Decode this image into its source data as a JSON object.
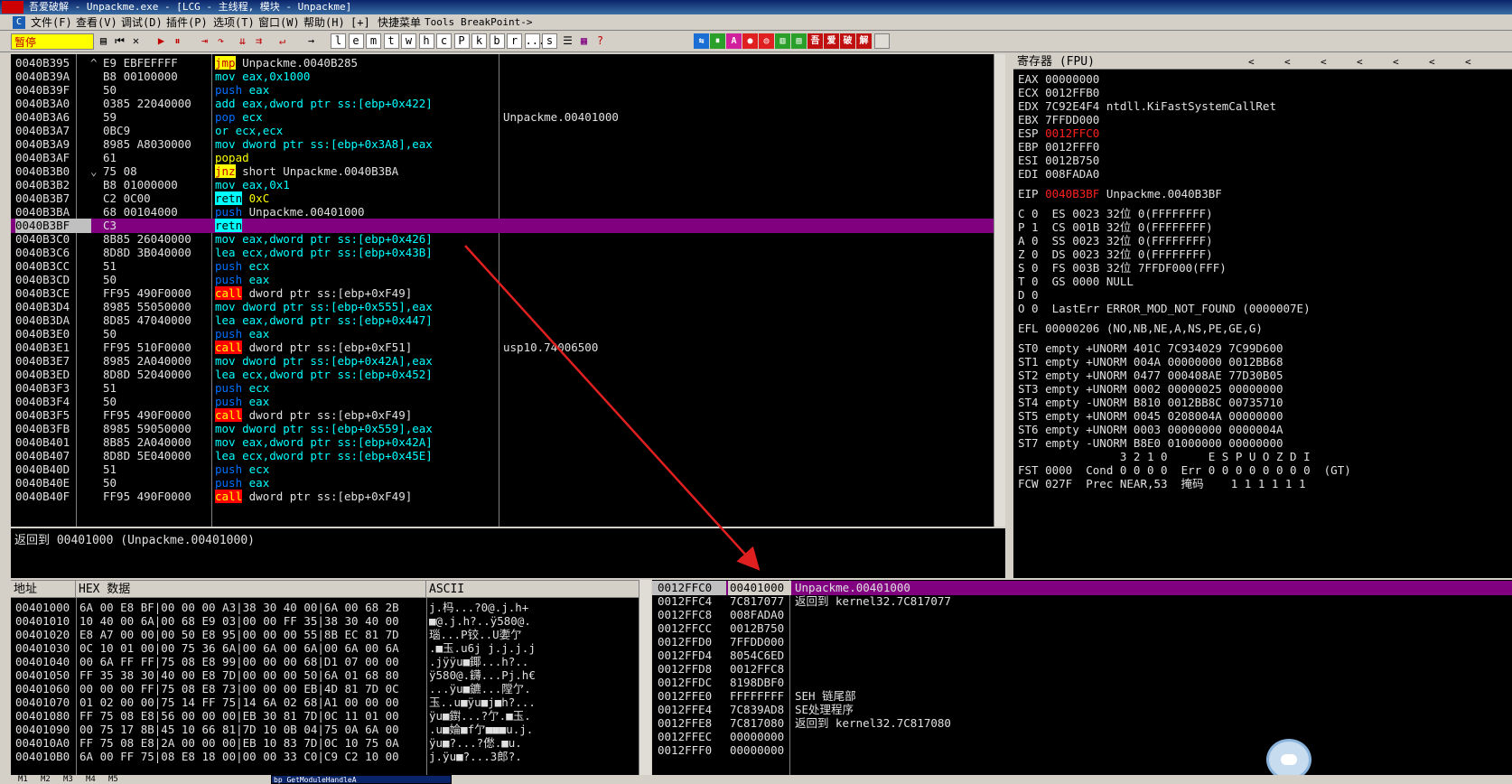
{
  "window": {
    "title": "吾爱破解 - Unpackme.exe - [LCG - 主线程, 模块 - Unpackme]",
    "logo_text": "吾爱破解"
  },
  "menu": [
    {
      "label": "文件(F)"
    },
    {
      "label": "查看(V)"
    },
    {
      "label": "调试(D)"
    },
    {
      "label": "插件(P)"
    },
    {
      "label": "选项(T)"
    },
    {
      "label": "窗口(W)"
    },
    {
      "label": "帮助(H)"
    },
    {
      "label": "[+]"
    },
    {
      "label": "快捷菜单"
    },
    {
      "label": "Tools"
    },
    {
      "label": "BreakPoint->"
    }
  ],
  "toolbar": {
    "status": "暂停",
    "letter_buttons": [
      "l",
      "e",
      "m",
      "t",
      "w",
      "h",
      "c",
      "P",
      "k",
      "b",
      "r",
      "...",
      "s"
    ],
    "colors": {
      "accent_yellow": "#ffff00",
      "selection_purple": "#800080"
    }
  },
  "cpu": {
    "rows": [
      {
        "addr": "0040B395",
        "mark": "^",
        "hex": "E9 EBFEFFFF",
        "mn": "jmp",
        "ops": "Unpackme.0040B285",
        "comment": ""
      },
      {
        "addr": "0040B39A",
        "mark": "",
        "hex": "B8 00100000",
        "mn": "mov",
        "ops": "eax,0x1000",
        "comment": ""
      },
      {
        "addr": "0040B39F",
        "mark": "",
        "hex": "50",
        "mn": "push",
        "ops": "eax",
        "comment": ""
      },
      {
        "addr": "0040B3A0",
        "mark": "",
        "hex": "0385 22040000",
        "mn": "add",
        "ops": "eax,dword ptr ss:[ebp+0x422]",
        "comment": ""
      },
      {
        "addr": "0040B3A6",
        "mark": "",
        "hex": "59",
        "mn": "pop",
        "ops": "ecx",
        "comment": "Unpackme.00401000"
      },
      {
        "addr": "0040B3A7",
        "mark": "",
        "hex": "0BC9",
        "mn": "or",
        "ops": "ecx,ecx",
        "comment": ""
      },
      {
        "addr": "0040B3A9",
        "mark": "",
        "hex": "8985 A8030000",
        "mn": "mov",
        "ops": "dword ptr ss:[ebp+0x3A8],eax",
        "comment": ""
      },
      {
        "addr": "0040B3AF",
        "mark": "",
        "hex": "61",
        "mn": "popad",
        "ops": "",
        "comment": ""
      },
      {
        "addr": "0040B3B0",
        "mark": "⌄",
        "hex": "75 08",
        "mn": "jnz",
        "ops": "short Unpackme.0040B3BA",
        "comment": ""
      },
      {
        "addr": "0040B3B2",
        "mark": "",
        "hex": "B8 01000000",
        "mn": "mov",
        "ops": "eax,0x1",
        "comment": ""
      },
      {
        "addr": "0040B3B7",
        "mark": "",
        "hex": "C2 0C00",
        "mn": "retn",
        "ops": "0xC",
        "comment": ""
      },
      {
        "addr": "0040B3BA",
        "mark": "",
        "hex": "68 00104000",
        "mn": "push",
        "ops": "Unpackme.00401000",
        "comment": ""
      },
      {
        "addr": "0040B3BF",
        "mark": "",
        "hex": "C3",
        "mn": "retn",
        "ops": "",
        "comment": "",
        "selected": true
      },
      {
        "addr": "0040B3C0",
        "mark": "",
        "hex": "8B85 26040000",
        "mn": "mov",
        "ops": "eax,dword ptr ss:[ebp+0x426]",
        "comment": ""
      },
      {
        "addr": "0040B3C6",
        "mark": "",
        "hex": "8D8D 3B040000",
        "mn": "lea",
        "ops": "ecx,dword ptr ss:[ebp+0x43B]",
        "comment": ""
      },
      {
        "addr": "0040B3CC",
        "mark": "",
        "hex": "51",
        "mn": "push",
        "ops": "ecx",
        "comment": ""
      },
      {
        "addr": "0040B3CD",
        "mark": "",
        "hex": "50",
        "mn": "push",
        "ops": "eax",
        "comment": ""
      },
      {
        "addr": "0040B3CE",
        "mark": "",
        "hex": "FF95 490F0000",
        "mn": "call",
        "ops": "dword ptr ss:[ebp+0xF49]",
        "comment": ""
      },
      {
        "addr": "0040B3D4",
        "mark": "",
        "hex": "8985 55050000",
        "mn": "mov",
        "ops": "dword ptr ss:[ebp+0x555],eax",
        "comment": ""
      },
      {
        "addr": "0040B3DA",
        "mark": "",
        "hex": "8D85 47040000",
        "mn": "lea",
        "ops": "eax,dword ptr ss:[ebp+0x447]",
        "comment": ""
      },
      {
        "addr": "0040B3E0",
        "mark": "",
        "hex": "50",
        "mn": "push",
        "ops": "eax",
        "comment": ""
      },
      {
        "addr": "0040B3E1",
        "mark": "",
        "hex": "FF95 510F0000",
        "mn": "call",
        "ops": "dword ptr ss:[ebp+0xF51]",
        "comment": "usp10.74006500"
      },
      {
        "addr": "0040B3E7",
        "mark": "",
        "hex": "8985 2A040000",
        "mn": "mov",
        "ops": "dword ptr ss:[ebp+0x42A],eax",
        "comment": ""
      },
      {
        "addr": "0040B3ED",
        "mark": "",
        "hex": "8D8D 52040000",
        "mn": "lea",
        "ops": "ecx,dword ptr ss:[ebp+0x452]",
        "comment": ""
      },
      {
        "addr": "0040B3F3",
        "mark": "",
        "hex": "51",
        "mn": "push",
        "ops": "ecx",
        "comment": ""
      },
      {
        "addr": "0040B3F4",
        "mark": "",
        "hex": "50",
        "mn": "push",
        "ops": "eax",
        "comment": ""
      },
      {
        "addr": "0040B3F5",
        "mark": "",
        "hex": "FF95 490F0000",
        "mn": "call",
        "ops": "dword ptr ss:[ebp+0xF49]",
        "comment": ""
      },
      {
        "addr": "0040B3FB",
        "mark": "",
        "hex": "8985 59050000",
        "mn": "mov",
        "ops": "dword ptr ss:[ebp+0x559],eax",
        "comment": ""
      },
      {
        "addr": "0040B401",
        "mark": "",
        "hex": "8B85 2A040000",
        "mn": "mov",
        "ops": "eax,dword ptr ss:[ebp+0x42A]",
        "comment": ""
      },
      {
        "addr": "0040B407",
        "mark": "",
        "hex": "8D8D 5E040000",
        "mn": "lea",
        "ops": "ecx,dword ptr ss:[ebp+0x45E]",
        "comment": ""
      },
      {
        "addr": "0040B40D",
        "mark": "",
        "hex": "51",
        "mn": "push",
        "ops": "ecx",
        "comment": ""
      },
      {
        "addr": "0040B40E",
        "mark": "",
        "hex": "50",
        "mn": "push",
        "ops": "eax",
        "comment": ""
      },
      {
        "addr": "0040B40F",
        "mark": "",
        "hex": "FF95 490F0000",
        "mn": "call",
        "ops": "dword ptr ss:[ebp+0xF49]",
        "comment": ""
      }
    ],
    "info": "返回到 00401000 (Unpackme.00401000)"
  },
  "registers": {
    "header": "寄存器 (FPU)",
    "lines": [
      {
        "t": "EAX 00000000"
      },
      {
        "t": "ECX 0012FFB0"
      },
      {
        "t": "EDX 7C92E4F4 ntdll.KiFastSystemCallRet"
      },
      {
        "t": "EBX 7FFDD000"
      },
      {
        "pre": "ESP ",
        "red": "0012FFC0",
        "post": ""
      },
      {
        "t": "EBP 0012FFF0"
      },
      {
        "t": "ESI 0012B750"
      },
      {
        "t": "EDI 008FADA0"
      },
      {
        "gap": true
      },
      {
        "pre": "EIP ",
        "red": "0040B3BF",
        "post": " Unpackme.0040B3BF"
      },
      {
        "gap": true
      },
      {
        "t": "C 0  ES 0023 32位 0(FFFFFFFF)"
      },
      {
        "t": "P 1  CS 001B 32位 0(FFFFFFFF)"
      },
      {
        "t": "A 0  SS 0023 32位 0(FFFFFFFF)"
      },
      {
        "t": "Z 0  DS 0023 32位 0(FFFFFFFF)"
      },
      {
        "t": "S 0  FS 003B 32位 7FFDF000(FFF)"
      },
      {
        "t": "T 0  GS 0000 NULL"
      },
      {
        "t": "D 0"
      },
      {
        "t": "O 0  LastErr ERROR_MOD_NOT_FOUND (0000007E)"
      },
      {
        "gap": true
      },
      {
        "t": "EFL 00000206 (NO,NB,NE,A,NS,PE,GE,G)"
      },
      {
        "gap": true
      },
      {
        "t": "ST0 empty +UNORM 401C 7C934029 7C99D600"
      },
      {
        "t": "ST1 empty +UNORM 004A 00000000 0012BB68"
      },
      {
        "t": "ST2 empty +UNORM 0477 000408AE 77D30B05"
      },
      {
        "t": "ST3 empty +UNORM 0002 00000025 00000000"
      },
      {
        "t": "ST4 empty -UNORM B810 0012BB8C 00735710"
      },
      {
        "t": "ST5 empty +UNORM 0045 0208004A 00000000"
      },
      {
        "t": "ST6 empty +UNORM 0003 00000000 0000004A"
      },
      {
        "t": "ST7 empty -UNORM B8E0 01000000 00000000"
      },
      {
        "t": "               3 2 1 0      E S P U O Z D I"
      },
      {
        "t": "FST 0000  Cond 0 0 0 0  Err 0 0 0 0 0 0 0 0  (GT)"
      },
      {
        "t": "FCW 027F  Prec NEAR,53  掩码    1 1 1 1 1 1"
      }
    ]
  },
  "dump": {
    "headers": {
      "addr": "地址",
      "hex": "HEX 数据",
      "ascii": "ASCII"
    },
    "rows": [
      {
        "a": "00401000",
        "h": "6A 00 E8 BF|00 00 00 A3|38 30 40 00|6A 00 68 2B",
        "s": "j.杩...?0@.j.h+"
      },
      {
        "a": "00401010",
        "h": "10 40 00 6A|00 68 E9 03|00 00 FF 35|38 30 40 00",
        "s": "■@.j.h?..ÿ580@."
      },
      {
        "a": "00401020",
        "h": "E8 A7 00 00|00 50 E8 95|00 00 00 55|8B EC 81 7D",
        "s": "瑙...P铰..U嬱亇"
      },
      {
        "a": "00401030",
        "h": "0C 10 01 00|00 75 36 6A|00 6A 00 6A|00 6A 00 6A",
        "s": ".■玉.u6j j.j.j.j"
      },
      {
        "a": "00401040",
        "h": "00 6A FF FF|75 08 E8 99|00 00 00 68|D1 07 00 00",
        "s": ".jÿÿu■鎁...h?.."
      },
      {
        "a": "00401050",
        "h": "FF 35 38 30|40 00 E8 7D|00 00 00 50|6A 01 68 80",
        "s": "ÿ580@.鑮...Pj.h€"
      },
      {
        "a": "00401060",
        "h": "00 00 00 FF|75 08 E8 73|00 00 00 EB|4D 81 7D 0C",
        "s": "...ÿu■鑣...隚亇."
      },
      {
        "a": "00401070",
        "h": "01 02 00 00|75 14 FF 75|14 6A 02 68|A1 00 00 00",
        "s": "玉..u■ÿu■j■h?..."
      },
      {
        "a": "00401080",
        "h": "FF 75 08 E8|56 00 00 00|EB 30 81 7D|0C 11 01 00",
        "s": "ÿu■鑆...?亇.■玉."
      },
      {
        "a": "00401090",
        "h": "00 75 17 8B|45 10 66 81|7D 10 0B 04|75 0A 6A 00",
        "s": ".u■婨■f亇■■■u.j."
      },
      {
        "a": "004010A0",
        "h": "FF 75 08 E8|2A 00 00 00|EB 10 83 7D|0C 10 75 0A",
        "s": "ÿu■?...?僽.■u."
      },
      {
        "a": "004010B0",
        "h": "6A 00 FF 75|08 E8 18 00|00 00 33 C0|C9 C2 10 00",
        "s": "j.ÿu■?...3郎?."
      }
    ]
  },
  "stack": {
    "rows": [
      {
        "a": "0012FFC0",
        "v": "00401000",
        "c": "Unpackme.00401000",
        "sel": true
      },
      {
        "a": "0012FFC4",
        "v": "7C817077",
        "c": "返回到 kernel32.7C817077"
      },
      {
        "a": "0012FFC8",
        "v": "008FADA0",
        "c": ""
      },
      {
        "a": "0012FFCC",
        "v": "0012B750",
        "c": ""
      },
      {
        "a": "0012FFD0",
        "v": "7FFDD000",
        "c": ""
      },
      {
        "a": "0012FFD4",
        "v": "8054C6ED",
        "c": ""
      },
      {
        "a": "0012FFD8",
        "v": "0012FFC8",
        "c": ""
      },
      {
        "a": "0012FFDC",
        "v": "8198DBF0",
        "c": ""
      },
      {
        "a": "0012FFE0",
        "v": "FFFFFFFF",
        "c": "SEH 链尾部"
      },
      {
        "a": "0012FFE4",
        "v": "7C839AD8",
        "c": "SE处理程序"
      },
      {
        "a": "0012FFE8",
        "v": "7C817080",
        "c": "返回到 kernel32.7C817080"
      },
      {
        "a": "0012FFEC",
        "v": "00000000",
        "c": ""
      },
      {
        "a": "0012FFF0",
        "v": "00000000",
        "c": ""
      }
    ]
  },
  "bottom": {
    "tabs": [
      "M1",
      "M2",
      "M3",
      "M4",
      "M5"
    ],
    "command": "bp GetModuleHandleA"
  }
}
